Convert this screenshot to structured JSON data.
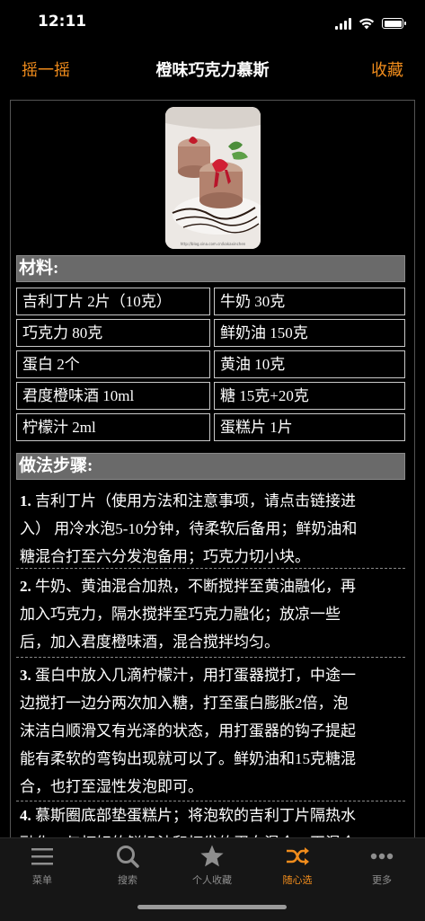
{
  "status": {
    "time": "12:11"
  },
  "nav": {
    "left": "摇一摇",
    "title": "橙味巧克力慕斯",
    "right": "收藏"
  },
  "photo": {
    "watermark": "http://blog.sina.com.cn/kakaxinchen"
  },
  "ingredients": {
    "header": "材料:",
    "items": [
      "吉利丁片 2片（10克）",
      "牛奶 30克",
      "巧克力 80克",
      "鲜奶油 150克",
      "蛋白 2个",
      "黄油 10克",
      "君度橙味酒 10ml",
      "糖 15克+20克",
      "柠檬汁 2ml",
      "蛋糕片 1片"
    ]
  },
  "steps": {
    "header": "做法步骤:",
    "items": [
      {
        "num": "1.",
        "lines": [
          "吉利丁片（使用方法和注意事项，请点击链接进",
          "入） 用冷水泡5-10分钟，待柔软后备用；鲜奶油和",
          "糖混合打至六分发泡备用；巧克力切小块。"
        ]
      },
      {
        "num": "2.",
        "lines": [
          "牛奶、黄油混合加热，不断搅拌至黄油融化，再",
          "加入巧克力，隔水搅拌至巧克力融化；放凉一些",
          "后，加入君度橙味酒，混合搅拌均匀。"
        ]
      },
      {
        "num": "3.",
        "lines": [
          "蛋白中放入几滴柠檬汁，用打蛋器搅打，中途一",
          "边搅打一边分两次加入糖，打至蛋白膨胀2倍，泡",
          "沫洁白顺滑又有光泽的状态，用打蛋器的钩子提起",
          "能有柔软的弯钩出现就可以了。鲜奶油和15克糖混",
          "合，也打至湿性发泡即可。"
        ]
      },
      {
        "num": "4.",
        "lines": [
          "慕斯圈底部垫蛋糕片；将泡软的吉利丁片隔热水",
          "融化，与打好的鲜奶油和打发的蛋白混合，再混合"
        ]
      }
    ]
  },
  "tabs": [
    {
      "label": "菜单",
      "icon": "menu-icon",
      "active": false
    },
    {
      "label": "搜索",
      "icon": "search-icon",
      "active": false
    },
    {
      "label": "个人收藏",
      "icon": "star-icon",
      "active": false
    },
    {
      "label": "随心选",
      "icon": "shuffle-icon",
      "active": true
    },
    {
      "label": "更多",
      "icon": "more-icon",
      "active": false
    }
  ],
  "colors": {
    "accent": "#f08c1c",
    "background": "#000000",
    "header_bg": "#6a6a6a",
    "tab_inactive": "#8e8e8e"
  }
}
